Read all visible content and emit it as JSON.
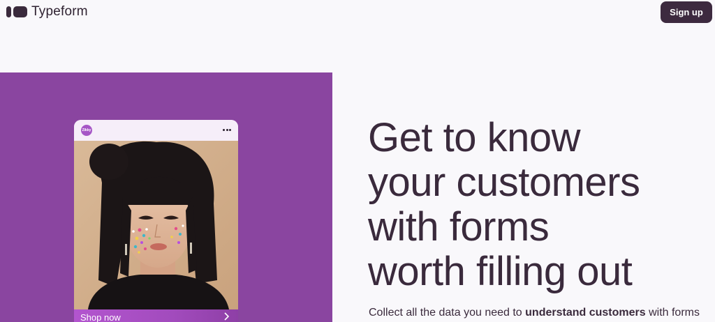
{
  "header": {
    "logo_text": "Typeform",
    "signup_label": "Sign up"
  },
  "card": {
    "brand_initials": "Zikky",
    "cta_label": "Shop now",
    "icons": [
      "more-horizontal-icon",
      "chevron-right-icon"
    ]
  },
  "hero": {
    "headline_lines": [
      "Get to know",
      "your customers",
      "with forms",
      "worth filling out"
    ],
    "sub_prefix": "Collect all the data you need to ",
    "sub_bold": "understand customers",
    "sub_suffix": " with forms"
  },
  "colors": {
    "panel": "#8a45a0",
    "button": "#3d2a3f",
    "text": "#3a2a3c",
    "background": "#f9f8fb"
  }
}
